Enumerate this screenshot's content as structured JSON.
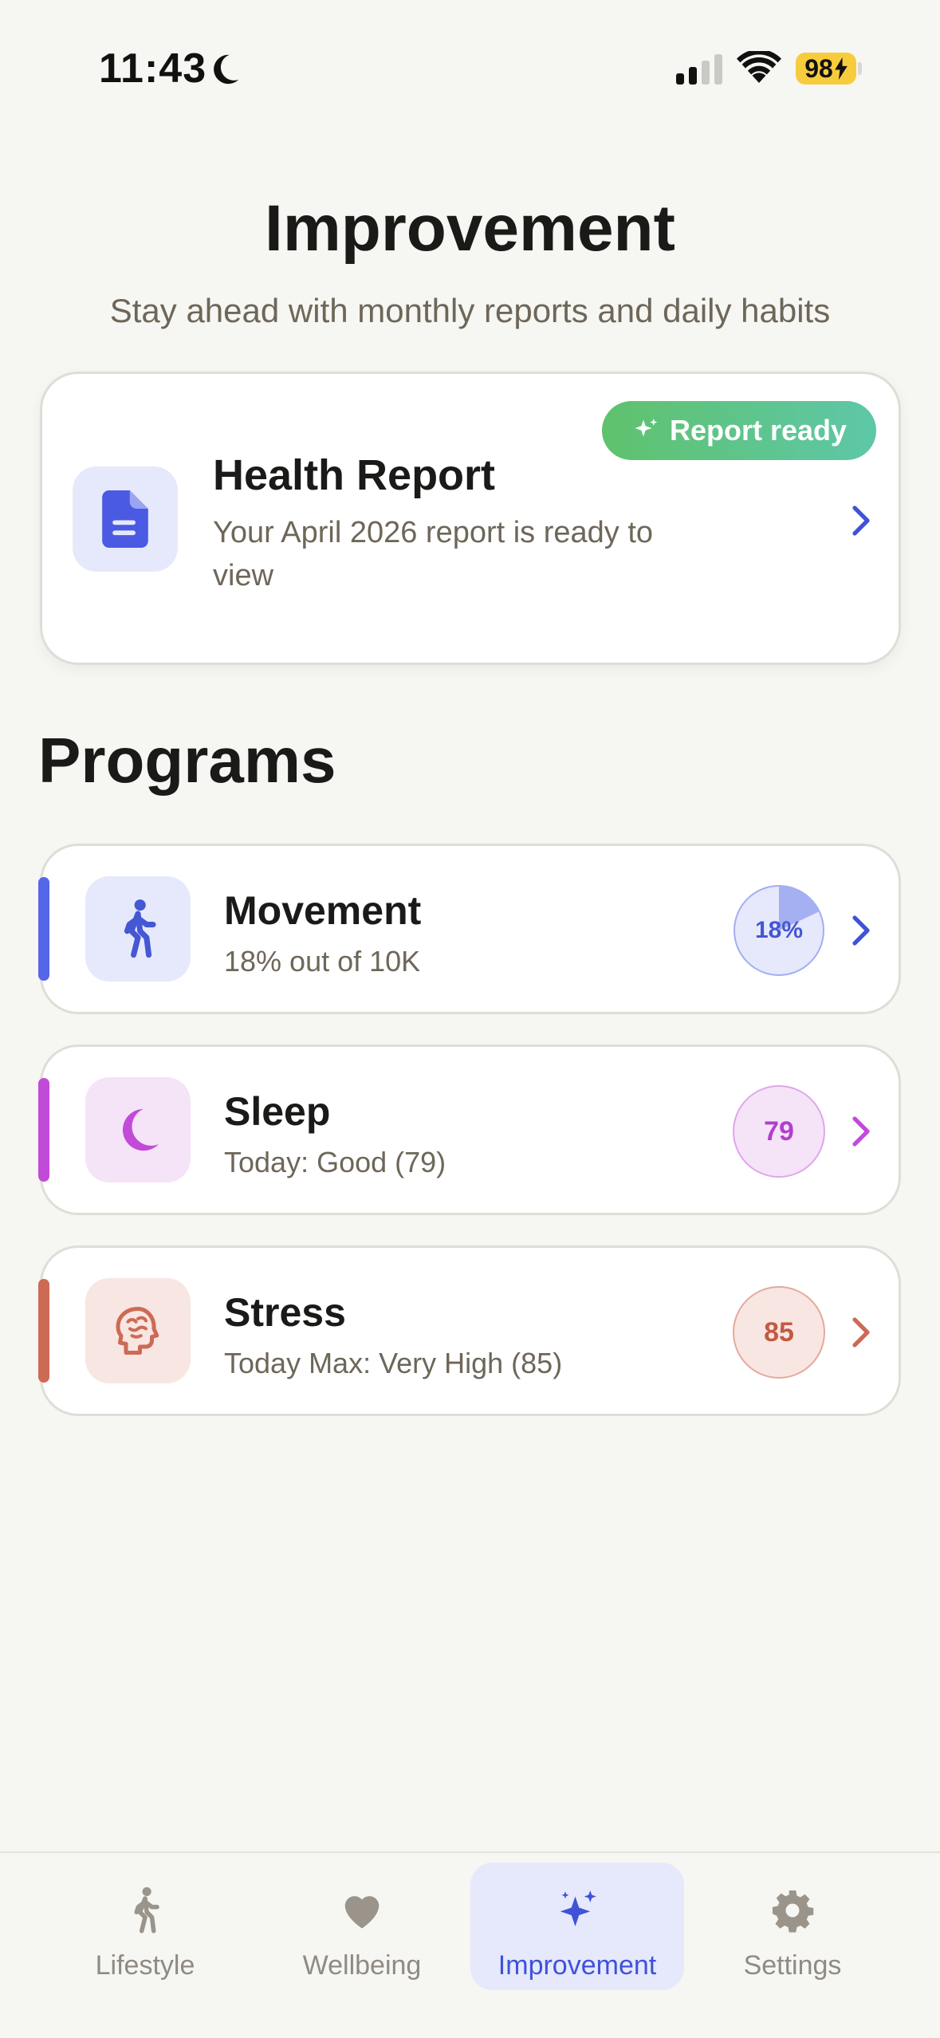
{
  "status_bar": {
    "time": "11:43",
    "battery": "98"
  },
  "header": {
    "title": "Improvement",
    "subtitle": "Stay ahead with monthly reports and daily habits"
  },
  "report": {
    "badge": "Report ready",
    "title": "Health Report",
    "description": "Your April 2026 report is ready to view",
    "icon": "document-icon"
  },
  "programs": {
    "title": "Programs",
    "items": [
      {
        "name": "Movement",
        "detail": "18% out of 10K",
        "score": "18%",
        "progress_percent": 18,
        "accent": "#5566e8",
        "tile": "#e6e9fb",
        "icon": "walking-icon"
      },
      {
        "name": "Sleep",
        "detail": "Today: Good (79)",
        "score": "79",
        "accent": "#c24ad9",
        "tile": "#f5e3f8",
        "icon": "moon-icon"
      },
      {
        "name": "Stress",
        "detail": "Today Max: Very High (85)",
        "score": "85",
        "accent": "#cd6a55",
        "tile": "#f8e6e2",
        "icon": "brain-icon"
      }
    ]
  },
  "tabs": [
    {
      "label": "Lifestyle",
      "icon": "walking-icon",
      "active": false
    },
    {
      "label": "Wellbeing",
      "icon": "heart-icon",
      "active": false
    },
    {
      "label": "Improvement",
      "icon": "sparkles-icon",
      "active": true
    },
    {
      "label": "Settings",
      "icon": "gear-icon",
      "active": false
    }
  ],
  "colors": {
    "background": "#f6f6f2",
    "primary": "#3f52d9",
    "badge_green": "#5fc26d"
  }
}
